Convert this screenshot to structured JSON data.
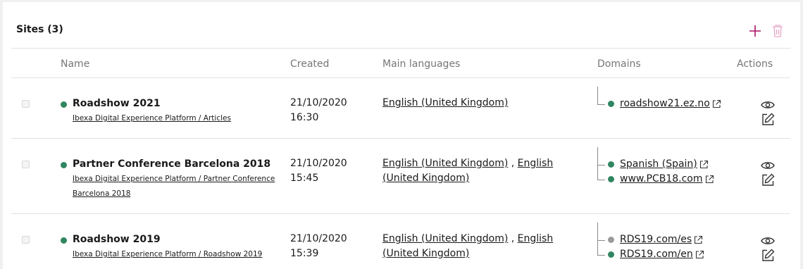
{
  "panel": {
    "title": "Sites (3)",
    "add_icon": "plus-icon",
    "delete_icon": "trash-icon"
  },
  "columns": {
    "name": "Name",
    "created": "Created",
    "languages": "Main languages",
    "domains": "Domains",
    "actions": "Actions"
  },
  "colors": {
    "status_active": "#2f8660",
    "status_inactive": "#9a9a9a",
    "accent": "#ae1164",
    "accent_disabled": "#e7a6c6"
  },
  "rows": [
    {
      "name": "Roadshow 2021",
      "path": "Ibexa Digital Experience Platform / Articles",
      "created_date": "21/10/2020",
      "created_time": "16:30",
      "lang1": "English (United Kingdom)",
      "lang_sep": "",
      "lang2": "",
      "domains": [
        {
          "label": "roadshow21.ez.no",
          "status": "active"
        }
      ]
    },
    {
      "name": "Partner Conference Barcelona 2018",
      "path": "Ibexa Digital Experience Platform / Partner Conference Barcelona 2018",
      "created_date": "21/10/2020",
      "created_time": "15:45",
      "lang1": "English (United Kingdom)",
      "lang_sep": " , ",
      "lang2": "English (United Kingdom)",
      "domains": [
        {
          "label": "Spanish (Spain)",
          "status": "active"
        },
        {
          "label": "www.PCB18.com",
          "status": "active"
        }
      ]
    },
    {
      "name": "Roadshow 2019",
      "path": "Ibexa Digital Experience Platform / Roadshow 2019",
      "created_date": "21/10/2020",
      "created_time": "15:39",
      "lang1": "English (United Kingdom)",
      "lang_sep": " , ",
      "lang2": "English (United Kingdom)",
      "domains": [
        {
          "label": "RDS19.com/es",
          "status": "inactive"
        },
        {
          "label": "RDS19.com/en",
          "status": "active"
        }
      ]
    }
  ],
  "row_actions": {
    "view_icon": "eye-icon",
    "edit_icon": "edit-icon"
  }
}
